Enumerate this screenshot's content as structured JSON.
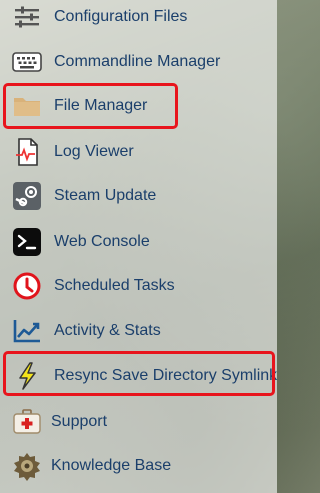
{
  "menu": {
    "items": [
      {
        "label": "Configuration Files",
        "icon": "sliders-icon"
      },
      {
        "label": "Commandline Manager",
        "icon": "keyboard-icon"
      },
      {
        "label": "File Manager",
        "icon": "folder-icon"
      },
      {
        "label": "Log Viewer",
        "icon": "log-file-icon"
      },
      {
        "label": "Steam Update",
        "icon": "steam-icon"
      },
      {
        "label": "Web Console",
        "icon": "terminal-icon"
      },
      {
        "label": "Scheduled Tasks",
        "icon": "clock-icon"
      },
      {
        "label": "Activity & Stats",
        "icon": "chart-icon"
      },
      {
        "label": "Resync Save Directory Symlink",
        "icon": "lightning-icon"
      },
      {
        "label": "Support",
        "icon": "first-aid-kit-icon"
      },
      {
        "label": "Knowledge Base",
        "icon": "knowledge-base-icon"
      }
    ]
  },
  "colors": {
    "label_text": "#1b3f6b",
    "highlight_border": "#e8141c"
  }
}
